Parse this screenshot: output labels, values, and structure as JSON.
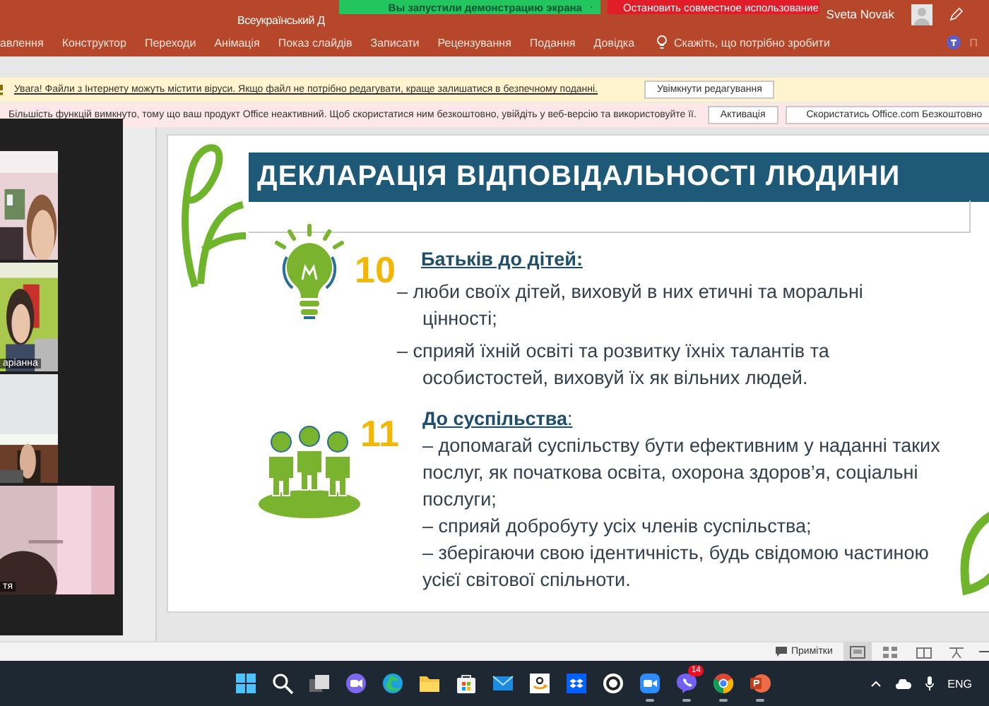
{
  "title_bar": {
    "title": "Всеукраїнський Д",
    "user": "Sveta Novak"
  },
  "share_banner": {
    "status": "Вы запустили демонстрацию экрана",
    "stop": "Остановить совместное использование"
  },
  "ribbon_tabs": [
    {
      "label": "авлення"
    },
    {
      "label": "Конструктор"
    },
    {
      "label": "Переходи"
    },
    {
      "label": "Анімація"
    },
    {
      "label": "Показ слайдів"
    },
    {
      "label": "Записати"
    },
    {
      "label": "Рецензування"
    },
    {
      "label": "Подання"
    },
    {
      "label": "Довідка"
    }
  ],
  "tell_me": "Скажіть, що потрібно зробити",
  "ribbon_cut_label": "П",
  "protected_view": {
    "message": "Увага! Файли з Інтернету можуть містити віруси. Якщо файл не потрібно редагувати, краще залишатися в безпечному поданні.",
    "button": "Увімкнути редагування"
  },
  "activation": {
    "message": "Більшість функцій вимкнуто, тому що ваш продукт Office неактивний. Щоб скористатися ним безкоштовно, увійдіть у веб-версію та використовуйте її.",
    "buttons": [
      "Активація",
      "Скористатись Office.com Безкоштовно"
    ]
  },
  "video_tiles": [
    {
      "kind": "picture"
    },
    {
      "kind": "picture",
      "name": "аріанна"
    },
    {
      "kind": "picture"
    },
    {
      "kind": "picture",
      "name": "тя"
    }
  ],
  "slide": {
    "title": "ДЕКЛАРАЦІЯ ВІДПОВІДАЛЬНОСТІ ЛЮДИНИ",
    "sections": [
      {
        "number": "10",
        "kind": "bulb",
        "heading": "**Батьків до дітей:**",
        "lines": [
          "– люби своїх дітей, виховуй в них етичні та моральні цінності;",
          "– сприяй їхній освіті та розвитку їхніх талантів та особистостей, виховуй їх як вільних людей."
        ]
      },
      {
        "number": "11",
        "kind": "people",
        "heading": "**До суспільства**:",
        "lines": [
          "– допомагай суспільству бути ефективним у наданні таких послуг, як початкова освіта, охорона здоров’я, соціальні послуги;",
          "– сприяй добробуту усіх членів суспільства;",
          "– зберігаючи свою ідентичність, будь свідомою частиною усієї світової спільноти."
        ]
      }
    ]
  },
  "status_bar": {
    "notes": "Примітки",
    "views": [
      {
        "kind": "normal",
        "selected": true
      },
      {
        "kind": "sorter",
        "selected": false
      },
      {
        "kind": "reading",
        "selected": false
      },
      {
        "kind": "slideshow",
        "selected": false
      }
    ]
  },
  "taskbar": {
    "apps": [
      {
        "kind": "windows",
        "running": false
      },
      {
        "kind": "search",
        "running": false
      },
      {
        "kind": "taskview",
        "running": false
      },
      {
        "kind": "chat",
        "running": false
      },
      {
        "kind": "edge",
        "running": false
      },
      {
        "kind": "folder",
        "running": false
      },
      {
        "kind": "store",
        "running": false
      },
      {
        "kind": "mail",
        "running": false
      },
      {
        "kind": "amazon",
        "running": false
      },
      {
        "kind": "dropbox",
        "running": false
      },
      {
        "kind": "ring",
        "running": false
      },
      {
        "kind": "zoom",
        "running": true
      },
      {
        "kind": "viber",
        "running": true,
        "badge": "14"
      },
      {
        "kind": "chrome",
        "running": true
      },
      {
        "kind": "powerpoint",
        "running": true
      }
    ],
    "language": "ENG"
  }
}
